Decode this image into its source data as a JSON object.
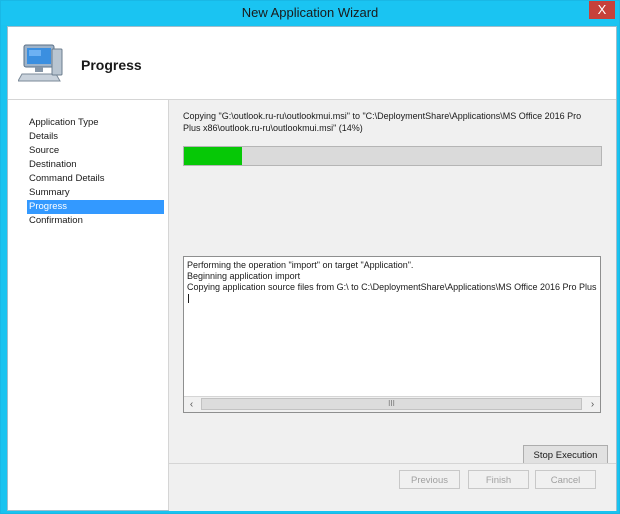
{
  "window": {
    "title": "New Application Wizard",
    "close_glyph": "X"
  },
  "header": {
    "title": "Progress",
    "icon": "computer-icon"
  },
  "nav": {
    "items": [
      {
        "label": "Application Type",
        "active": false
      },
      {
        "label": "Details",
        "active": false
      },
      {
        "label": "Source",
        "active": false
      },
      {
        "label": "Destination",
        "active": false
      },
      {
        "label": "Command Details",
        "active": false
      },
      {
        "label": "Summary",
        "active": false
      },
      {
        "label": "Progress",
        "active": true
      },
      {
        "label": "Confirmation",
        "active": false
      }
    ]
  },
  "status": {
    "copy_line1": "Copying \"G:\\outlook.ru-ru\\outlookmui.msi\" to \"C:\\DeploymentShare\\Applications\\MS Office 2016 Pro",
    "copy_line2": "Plus x86\\outlook.ru-ru\\outlookmui.msi\" (14%)",
    "progress_fraction": 0.14,
    "progress_color": "#06c806"
  },
  "log": {
    "lines": [
      "Performing the operation \"import\" on target \"Application\".",
      "Beginning application import",
      "Copying application source files from G:\\ to C:\\DeploymentShare\\Applications\\MS Office 2016 Pro Plus"
    ],
    "thumb_glyph": "III"
  },
  "buttons": {
    "stop": "Stop Execution",
    "previous": "Previous",
    "finish": "Finish",
    "cancel": "Cancel"
  }
}
